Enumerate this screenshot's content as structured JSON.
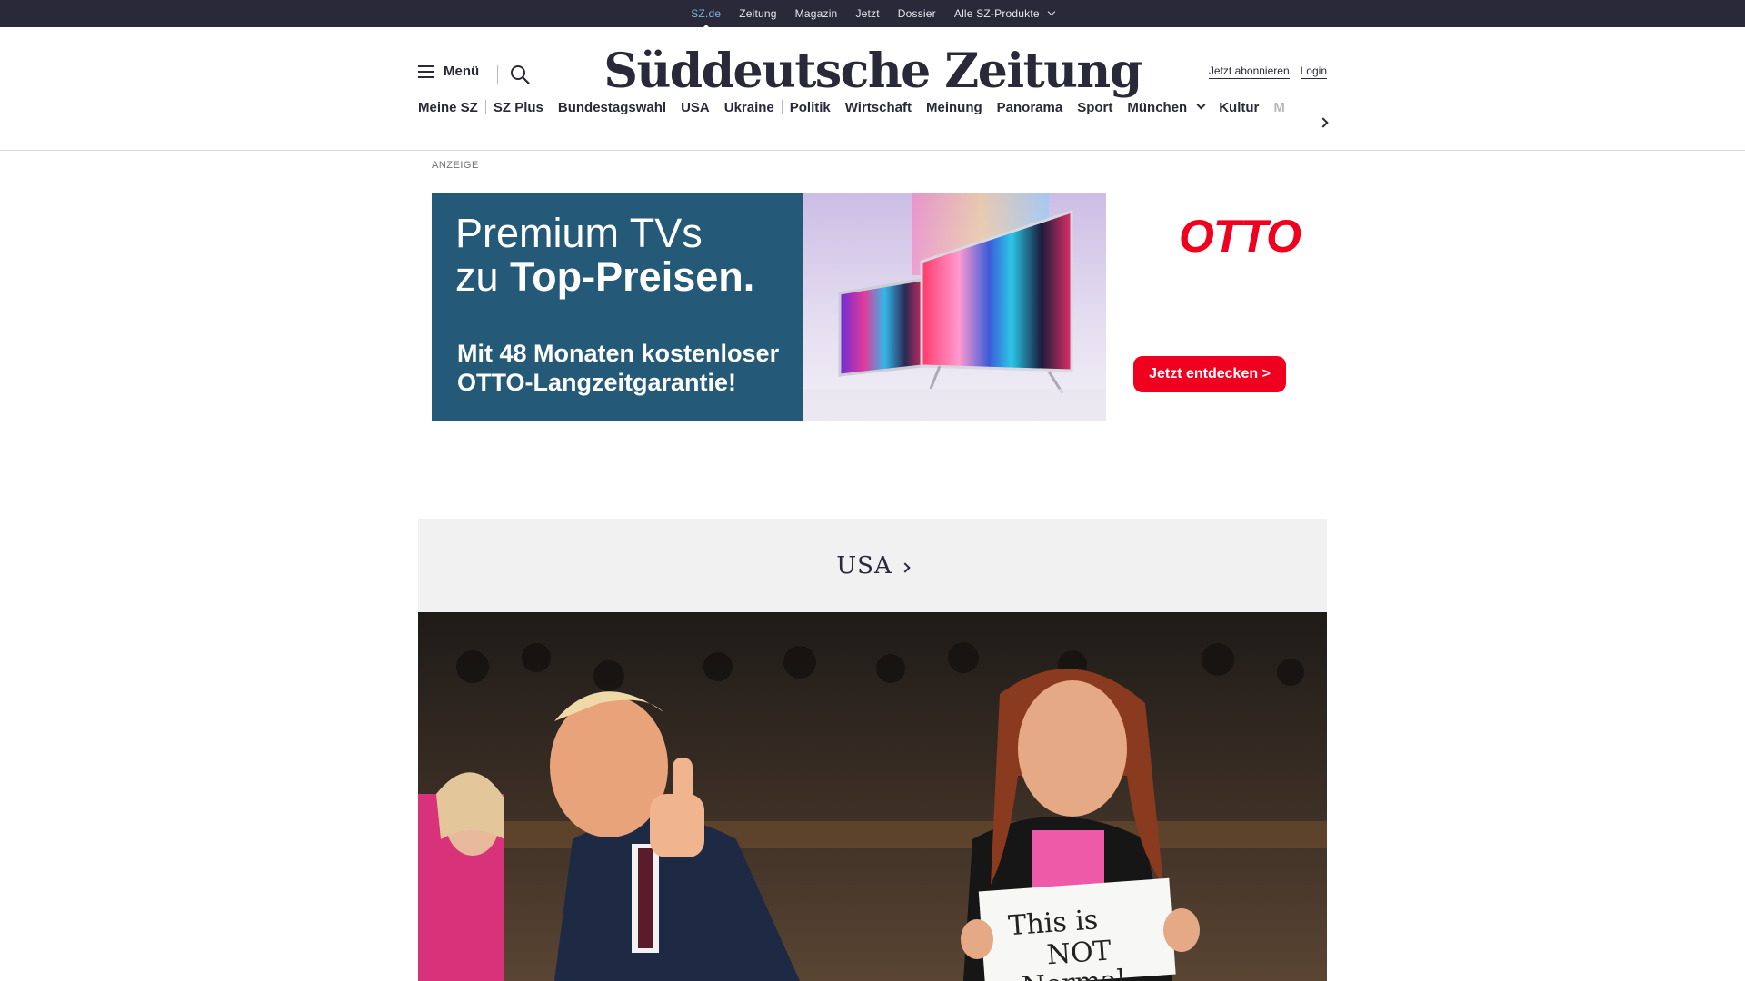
{
  "topbar": {
    "links": [
      {
        "label": "SZ.de"
      },
      {
        "label": "Zeitung"
      },
      {
        "label": "Magazin"
      },
      {
        "label": "Jetzt"
      },
      {
        "label": "Dossier"
      },
      {
        "label": "Alle SZ-Produkte"
      }
    ]
  },
  "header": {
    "menu_label": "Menü",
    "logo_text": "Süddeutsche Zeitung",
    "subscribe_label": "Jetzt abonnieren",
    "login_label": "Login"
  },
  "nav": {
    "items": [
      {
        "label": "Meine SZ"
      },
      {
        "label": "SZ Plus"
      },
      {
        "label": "Bundestagswahl"
      },
      {
        "label": "USA"
      },
      {
        "label": "Ukraine"
      },
      {
        "label": "Politik"
      },
      {
        "label": "Wirtschaft"
      },
      {
        "label": "Meinung"
      },
      {
        "label": "Panorama"
      },
      {
        "label": "Sport"
      },
      {
        "label": "München"
      },
      {
        "label": "Kultur"
      },
      {
        "label": "M"
      }
    ]
  },
  "ad": {
    "label": "ANZEIGE",
    "headline_1": "Premium TVs",
    "headline_2a": "zu ",
    "headline_2b": "Top-Preisen.",
    "subline": "Mit 48 Monaten kostenloser OTTO-Langzeitgarantie!",
    "brand": "OTTO",
    "cta": "Jetzt entdecken >"
  },
  "section": {
    "title": "USA"
  },
  "hero": {
    "sign_text_1": "This is",
    "sign_text_2": "NOT",
    "sign_text_3": "Normal"
  },
  "colors": {
    "topbar_bg": "#29293a",
    "active_link": "#7fb0d8",
    "ad_blue": "#245a77",
    "otto_red": "#f0001e",
    "section_bg": "#f1f1f1"
  }
}
